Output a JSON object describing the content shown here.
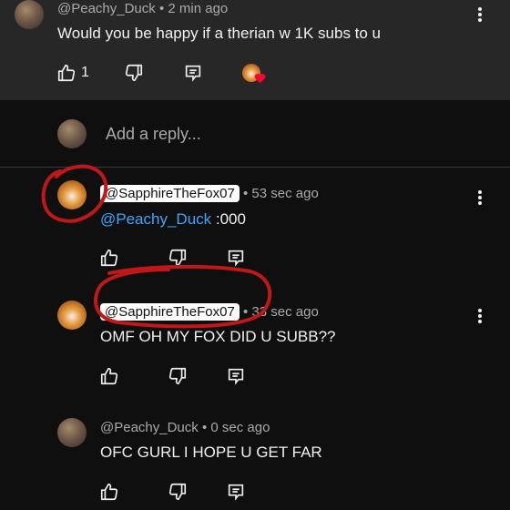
{
  "top_comment": {
    "author": "@Peachy_Duck",
    "time": "2 min ago",
    "text": "Would you be happy if a therian w 1K subs to u",
    "likes": "1"
  },
  "reply_box": {
    "placeholder": "Add a reply..."
  },
  "replies": [
    {
      "author": "@SapphireTheFox07",
      "time": "53 sec ago",
      "mention": "@Peachy_Duck",
      "text": " :000"
    },
    {
      "author": "@SapphireTheFox07",
      "time": "33 sec ago",
      "text": "OMF OH MY FOX DID U SUBB??"
    },
    {
      "author": "@Peachy_Duck",
      "time": "0 sec ago",
      "text": "OFC GURL I HOPE U GET FAR"
    }
  ],
  "separator": "•",
  "colors": {
    "annotation": "#c01818",
    "mention": "#3ea6ff",
    "heart": "#ff0033"
  }
}
